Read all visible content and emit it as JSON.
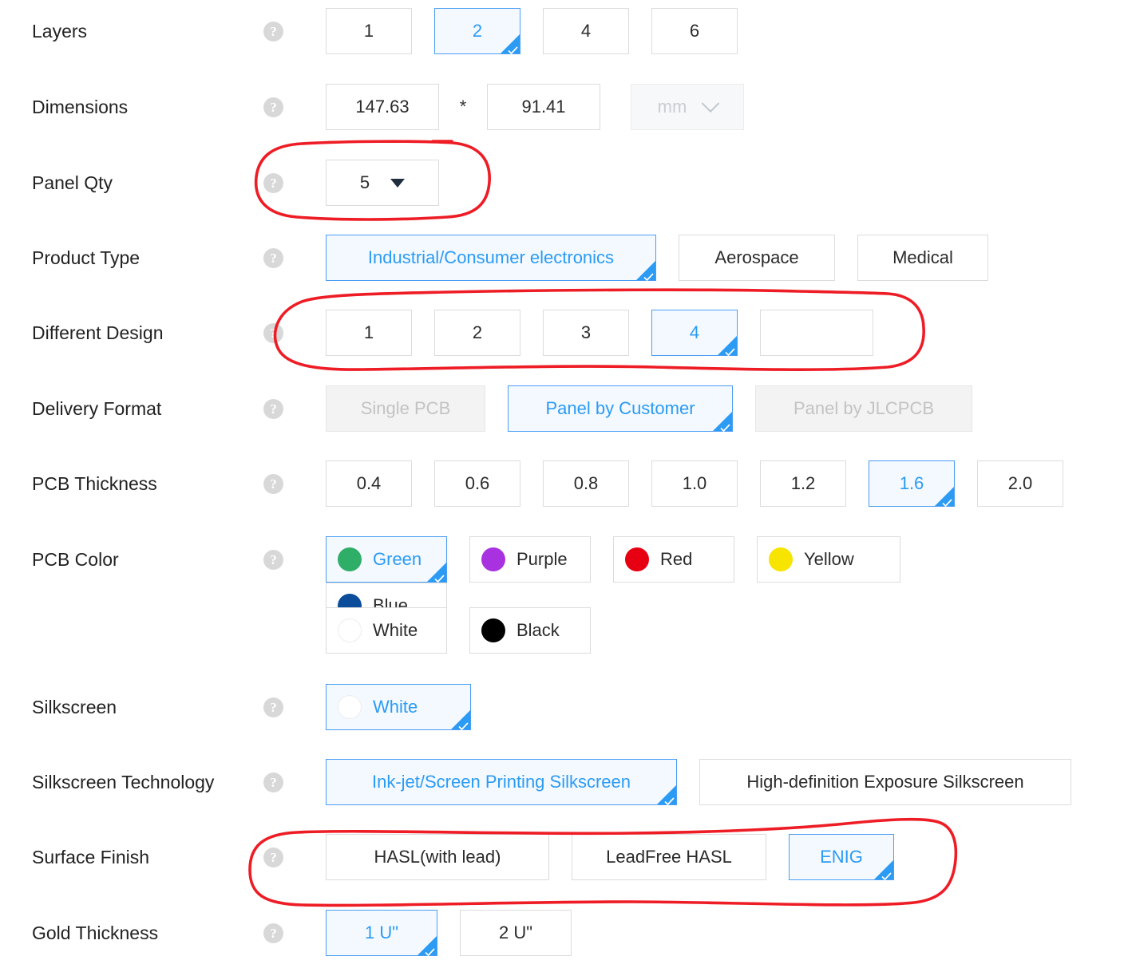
{
  "form": {
    "rows": [
      {
        "label": "Layers",
        "help": "?",
        "options": [
          {
            "label": "1",
            "selected": false
          },
          {
            "label": "2",
            "selected": true
          },
          {
            "label": "4",
            "selected": false
          },
          {
            "label": "6",
            "selected": false
          }
        ]
      },
      {
        "label": "Dimensions",
        "help": "?",
        "width_value": "147.63",
        "separator": "*",
        "height_value": "91.41",
        "unit_value": "mm"
      },
      {
        "label": "Panel Qty",
        "help": "?",
        "qty_value": "5"
      },
      {
        "label": "Product Type",
        "help": "?",
        "options": [
          {
            "label": "Industrial/Consumer electronics",
            "selected": true
          },
          {
            "label": "Aerospace",
            "selected": false
          },
          {
            "label": "Medical",
            "selected": false
          }
        ]
      },
      {
        "label": "Different Design",
        "help": "?",
        "options": [
          {
            "label": "1",
            "selected": false
          },
          {
            "label": "2",
            "selected": false
          },
          {
            "label": "3",
            "selected": false
          },
          {
            "label": "4",
            "selected": true
          }
        ],
        "custom_value": ""
      },
      {
        "label": "Delivery Format",
        "help": "?",
        "options": [
          {
            "label": "Single PCB",
            "selected": false,
            "disabled": true
          },
          {
            "label": "Panel by Customer",
            "selected": true,
            "disabled": false
          },
          {
            "label": "Panel by JLCPCB",
            "selected": false,
            "disabled": true
          }
        ]
      },
      {
        "label": "PCB Thickness",
        "help": "?",
        "options": [
          {
            "label": "0.4",
            "selected": false
          },
          {
            "label": "0.6",
            "selected": false
          },
          {
            "label": "0.8",
            "selected": false
          },
          {
            "label": "1.0",
            "selected": false
          },
          {
            "label": "1.2",
            "selected": false
          },
          {
            "label": "1.6",
            "selected": true
          },
          {
            "label": "2.0",
            "selected": false
          }
        ]
      },
      {
        "label": "PCB Color",
        "help": "?",
        "options": [
          {
            "label": "Green",
            "selected": true,
            "color": "#2FAE68"
          },
          {
            "label": "Purple",
            "selected": false,
            "color": "#A832E0"
          },
          {
            "label": "Red",
            "selected": false,
            "color": "#E60012"
          },
          {
            "label": "Yellow",
            "selected": false,
            "color": "#F7E400"
          },
          {
            "label": "Blue",
            "selected": false,
            "color": "#0B4C9B"
          },
          {
            "label": "White",
            "selected": false,
            "color": "#FFFFFF"
          },
          {
            "label": "Black",
            "selected": false,
            "color": "#000000"
          }
        ]
      },
      {
        "label": "Silkscreen",
        "help": "?",
        "options": [
          {
            "label": "White",
            "selected": true,
            "color": "#FFFFFF"
          }
        ]
      },
      {
        "label": "Silkscreen Technology",
        "help": "?",
        "options": [
          {
            "label": "Ink-jet/Screen Printing Silkscreen",
            "selected": true
          },
          {
            "label": "High-definition Exposure Silkscreen",
            "selected": false
          }
        ]
      },
      {
        "label": "Surface Finish",
        "help": "?",
        "options": [
          {
            "label": "HASL(with lead)",
            "selected": false
          },
          {
            "label": "LeadFree HASL",
            "selected": false
          },
          {
            "label": "ENIG",
            "selected": true
          }
        ]
      },
      {
        "label": "Gold Thickness",
        "help": "?",
        "options": [
          {
            "label": "1 U\"",
            "selected": true
          },
          {
            "label": "2 U\"",
            "selected": false
          }
        ]
      }
    ]
  },
  "annotations": {
    "color": "#EE1C25",
    "marks": [
      "panel-qty-circle",
      "different-design-circle",
      "surface-finish-circle"
    ]
  },
  "theme": {
    "accent": "#2b9bf4",
    "selected_bg": "#f4f9ff",
    "border": "#dcdcdc",
    "text": "#2b2b2b",
    "disabled_text": "#c3c3c3"
  }
}
